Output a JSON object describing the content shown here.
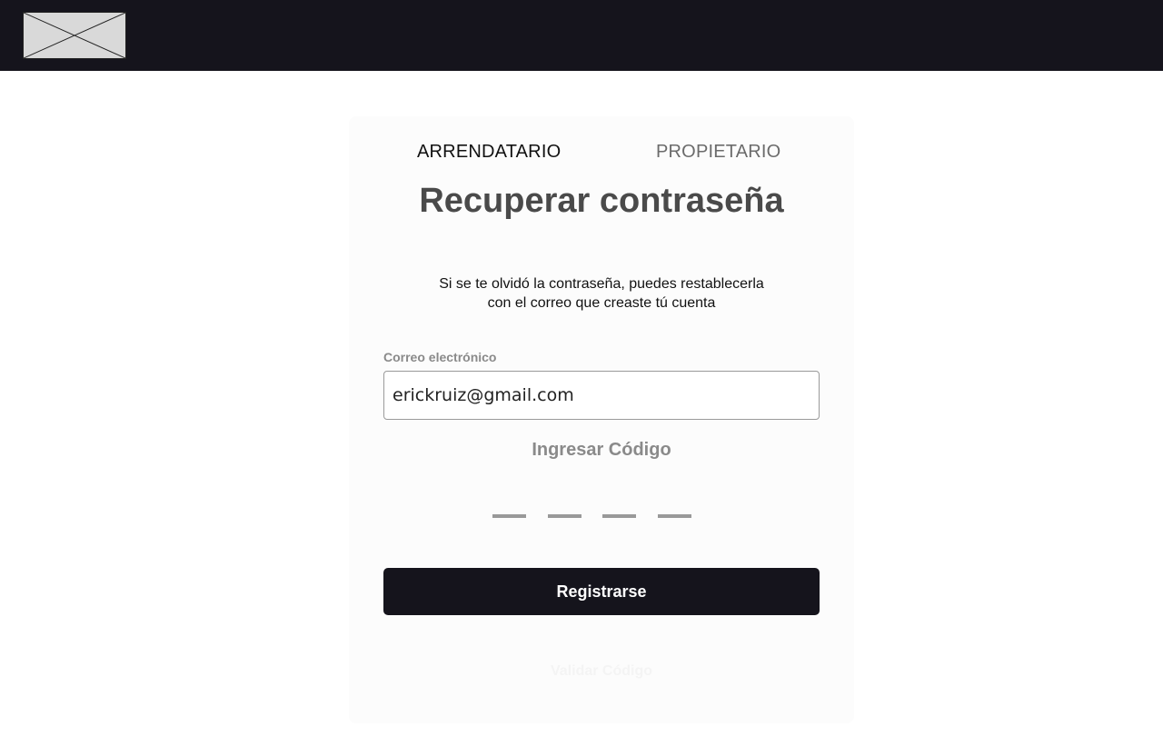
{
  "header": {
    "logo_icon": "image-placeholder-icon"
  },
  "tabs": [
    {
      "label": "ARRENDATARIO",
      "active": true
    },
    {
      "label": "PROPIETARIO",
      "active": false
    }
  ],
  "form": {
    "title": "Recuperar contraseña",
    "description_line1": "Si se te olvidó la contraseña, puedes restablecerla",
    "description_line2": "con el correo que creaste tú cuenta",
    "email_label": "Correo electrónico",
    "email_value": "erickruiz@gmail.com",
    "code_title": "Ingresar Código",
    "code_digits": [
      "",
      "",
      "",
      ""
    ],
    "submit_label": "Registrarse",
    "resend_label": "Validar Código"
  },
  "colors": {
    "header_bg": "#15141c",
    "button_bg": "#15141c",
    "card_bg": "#fcfcfc",
    "title": "#4a4a4a",
    "muted": "#8a8a8a"
  }
}
